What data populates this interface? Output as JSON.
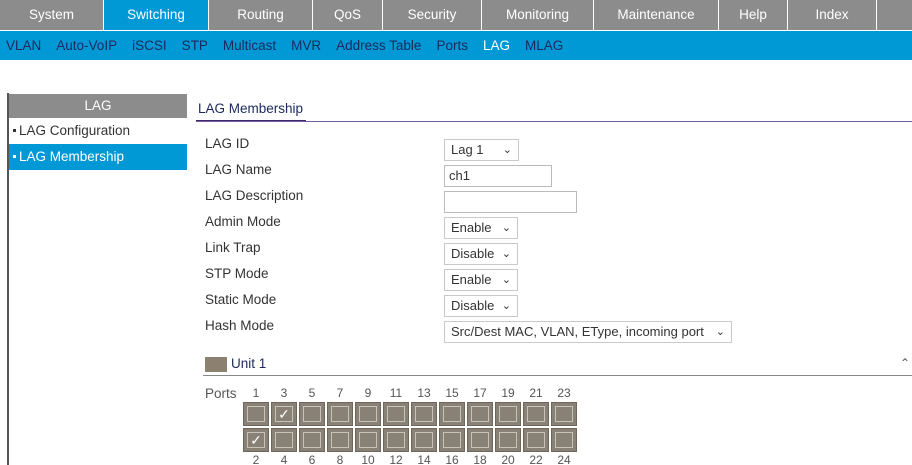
{
  "top_nav": [
    {
      "label": "System",
      "active": false
    },
    {
      "label": "Switching",
      "active": true
    },
    {
      "label": "Routing",
      "active": false
    },
    {
      "label": "QoS",
      "active": false
    },
    {
      "label": "Security",
      "active": false
    },
    {
      "label": "Monitoring",
      "active": false
    },
    {
      "label": "Maintenance",
      "active": false
    },
    {
      "label": "Help",
      "active": false
    },
    {
      "label": "Index",
      "active": false
    }
  ],
  "sub_nav": [
    {
      "label": "VLAN",
      "active": false
    },
    {
      "label": "Auto-VoIP",
      "active": false
    },
    {
      "label": "iSCSI",
      "active": false
    },
    {
      "label": "STP",
      "active": false
    },
    {
      "label": "Multicast",
      "active": false
    },
    {
      "label": "MVR",
      "active": false
    },
    {
      "label": "Address Table",
      "active": false
    },
    {
      "label": "Ports",
      "active": false
    },
    {
      "label": "LAG",
      "active": true
    },
    {
      "label": "MLAG",
      "active": false
    }
  ],
  "sidebar": {
    "title": "LAG",
    "items": [
      {
        "label": "LAG Configuration",
        "active": false
      },
      {
        "label": "LAG Membership",
        "active": true
      }
    ]
  },
  "section": {
    "title": "LAG Membership"
  },
  "form": {
    "lag_id": {
      "label": "LAG ID",
      "value": "Lag 1"
    },
    "lag_name": {
      "label": "LAG Name",
      "value": "ch1"
    },
    "lag_description": {
      "label": "LAG Description",
      "value": ""
    },
    "admin_mode": {
      "label": "Admin Mode",
      "value": "Enable"
    },
    "link_trap": {
      "label": "Link Trap",
      "value": "Disable"
    },
    "stp_mode": {
      "label": "STP Mode",
      "value": "Enable"
    },
    "static_mode": {
      "label": "Static Mode",
      "value": "Disable"
    },
    "hash_mode": {
      "label": "Hash Mode",
      "value": "Src/Dest MAC, VLAN, EType, incoming port"
    }
  },
  "unit": {
    "label": "Unit 1",
    "collapse_icon": "caret-up"
  },
  "ports": {
    "label": "Ports",
    "odd_numbers": [
      "1",
      "3",
      "5",
      "7",
      "9",
      "11",
      "13",
      "15",
      "17",
      "19",
      "21",
      "23"
    ],
    "even_numbers": [
      "2",
      "4",
      "6",
      "8",
      "10",
      "12",
      "14",
      "16",
      "18",
      "20",
      "22",
      "24"
    ],
    "selected": [
      2,
      3
    ],
    "check_glyph": "✓"
  },
  "colors": {
    "accent": "#0099d6",
    "nav_gray": "#8c8c8c",
    "port": "#898176"
  }
}
